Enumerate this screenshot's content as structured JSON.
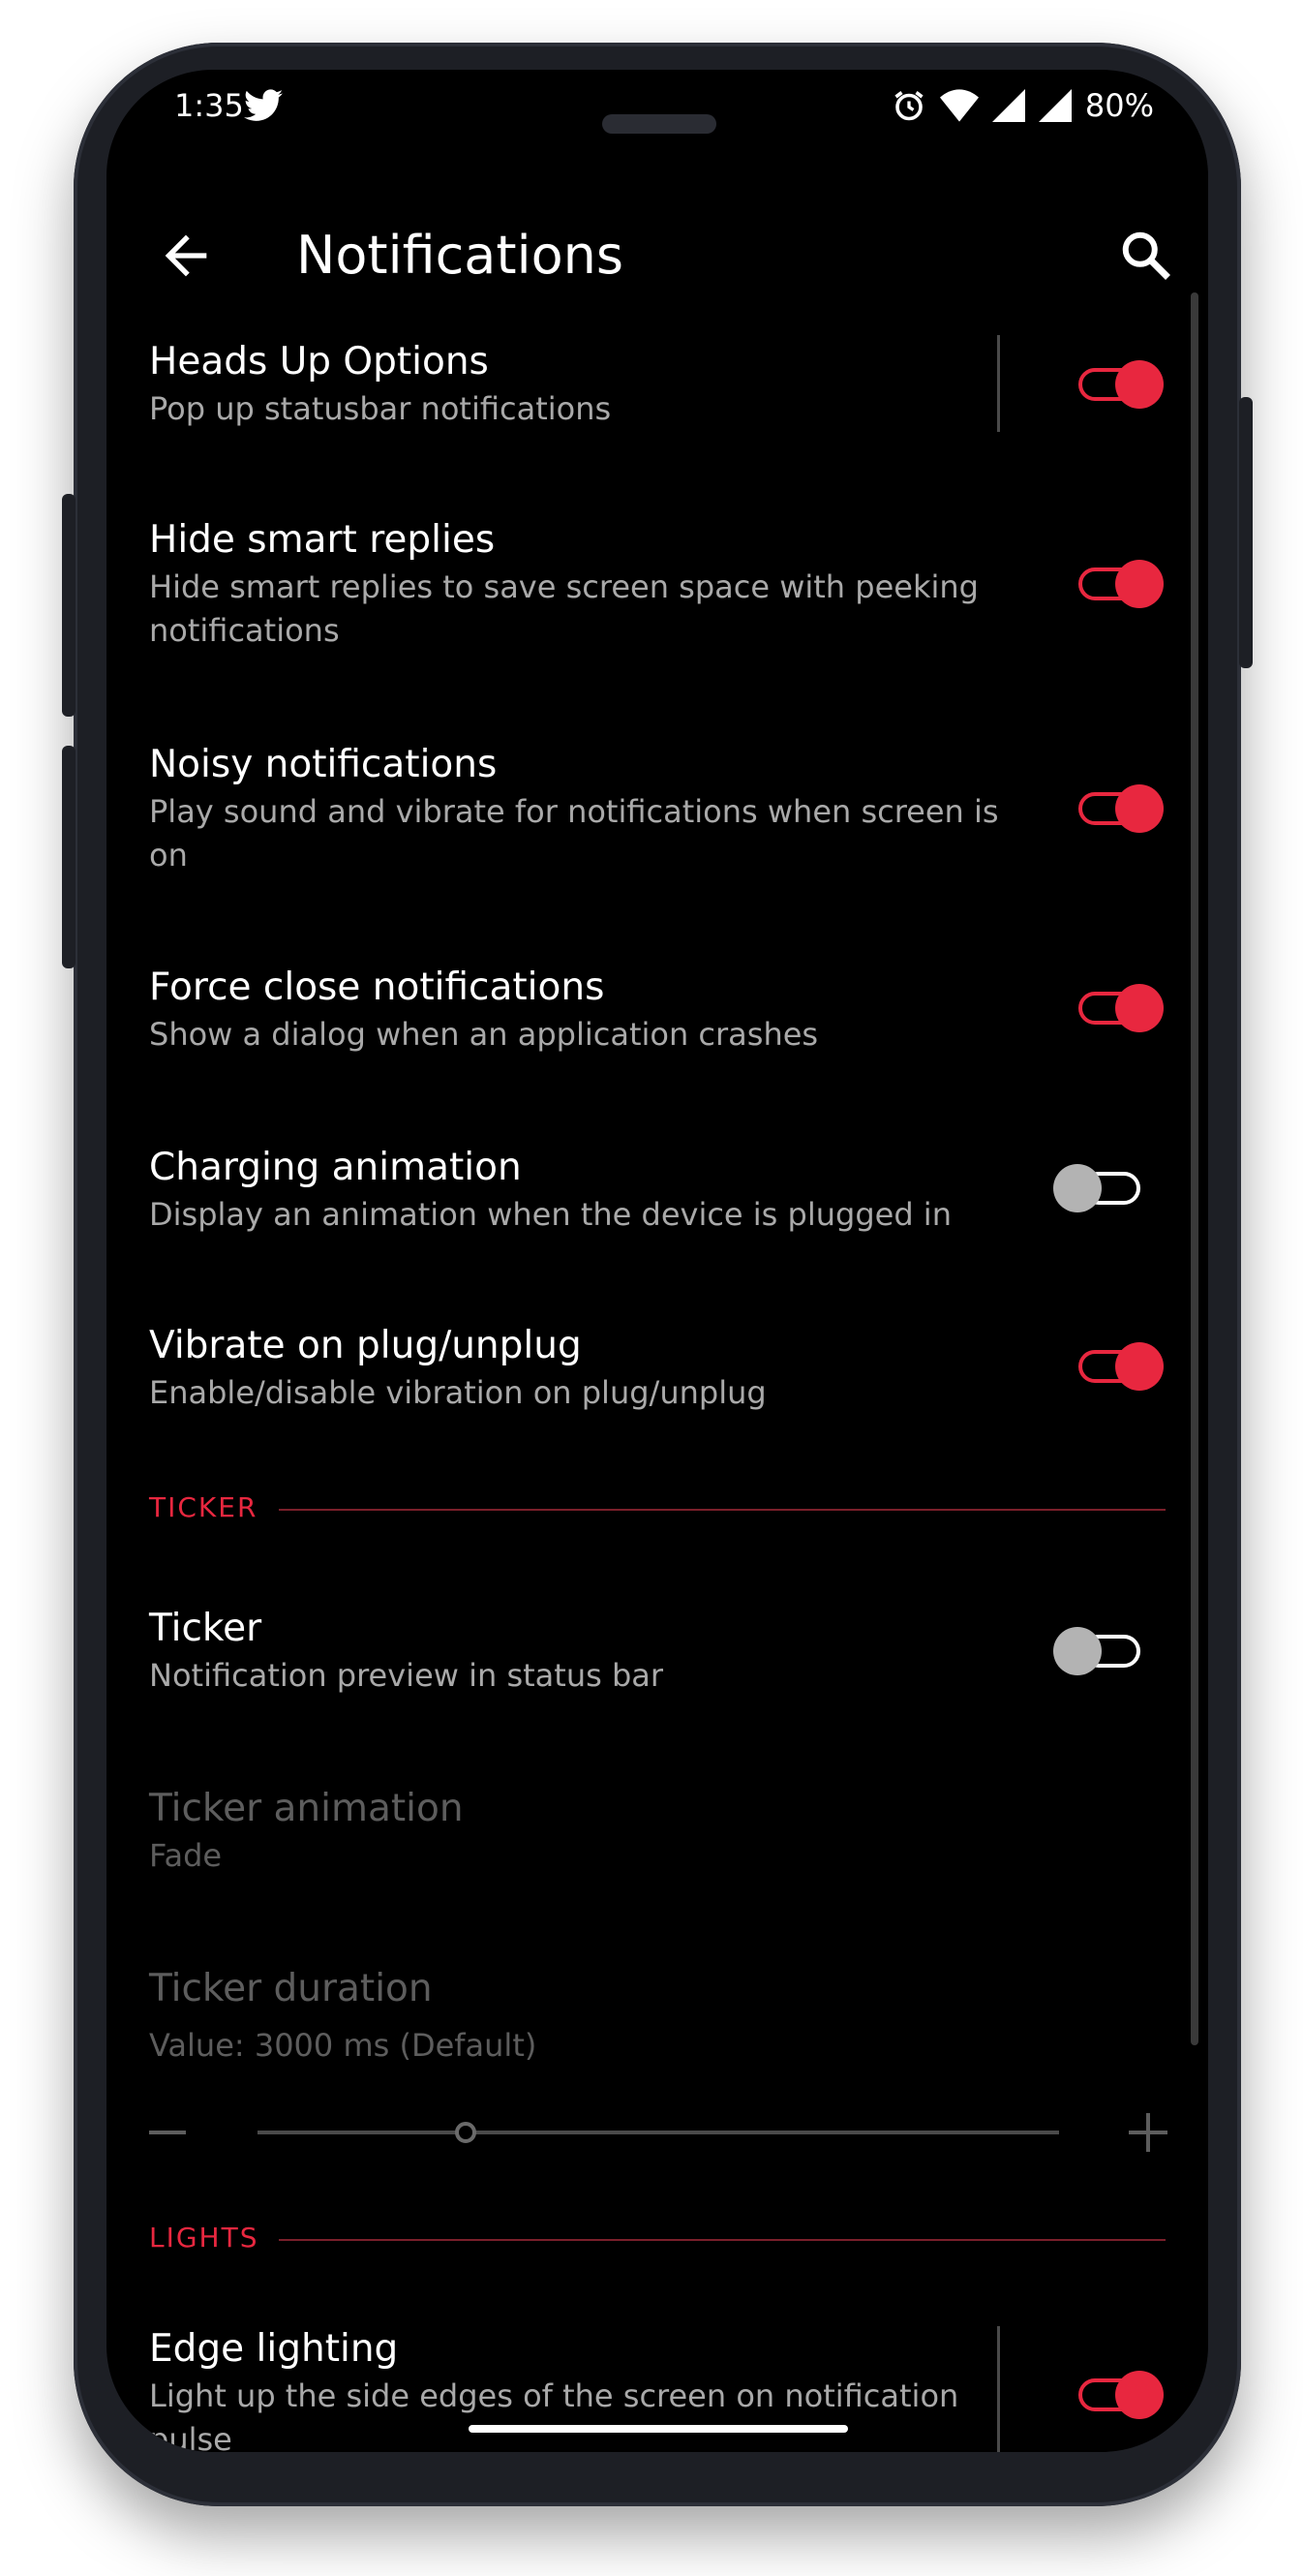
{
  "status_bar": {
    "time": "1:35",
    "battery": "80%",
    "icons": [
      "twitter-icon",
      "alarm-icon",
      "wifi-icon",
      "signal-icon",
      "signal-icon"
    ]
  },
  "app_bar": {
    "title": "Notifications"
  },
  "accent_color": "#e8273f",
  "preferences": [
    {
      "title": "Heads Up Options",
      "summary": "Pop up statusbar notifications",
      "enabled": true
    },
    {
      "title": "Hide smart replies",
      "summary": "Hide smart replies to save screen space with peeking notifications",
      "enabled": true
    },
    {
      "title": "Noisy notifications",
      "summary": "Play sound and vibrate for notifications when screen is on",
      "enabled": true
    },
    {
      "title": "Force close notifications",
      "summary": "Show a dialog when an application crashes",
      "enabled": true
    },
    {
      "title": "Charging animation",
      "summary": "Display an animation when the device is plugged in",
      "enabled": false
    },
    {
      "title": "Vibrate on plug/unplug",
      "summary": "Enable/disable vibration on plug/unplug",
      "enabled": true
    }
  ],
  "ticker_section": {
    "header": "TICKER",
    "ticker": {
      "title": "Ticker",
      "summary": "Notification preview in status bar",
      "enabled": false
    },
    "ticker_animation": {
      "title": "Ticker animation",
      "summary": "Fade"
    },
    "ticker_duration": {
      "title": "Ticker duration",
      "summary": "Value: 3000 ms (Default)",
      "slider_fraction": 0.26
    }
  },
  "lights_section": {
    "header": "LIGHTS",
    "edge_lighting": {
      "title": "Edge lighting",
      "summary": "Light up the side edges of the screen on notification pulse",
      "enabled": true
    }
  }
}
